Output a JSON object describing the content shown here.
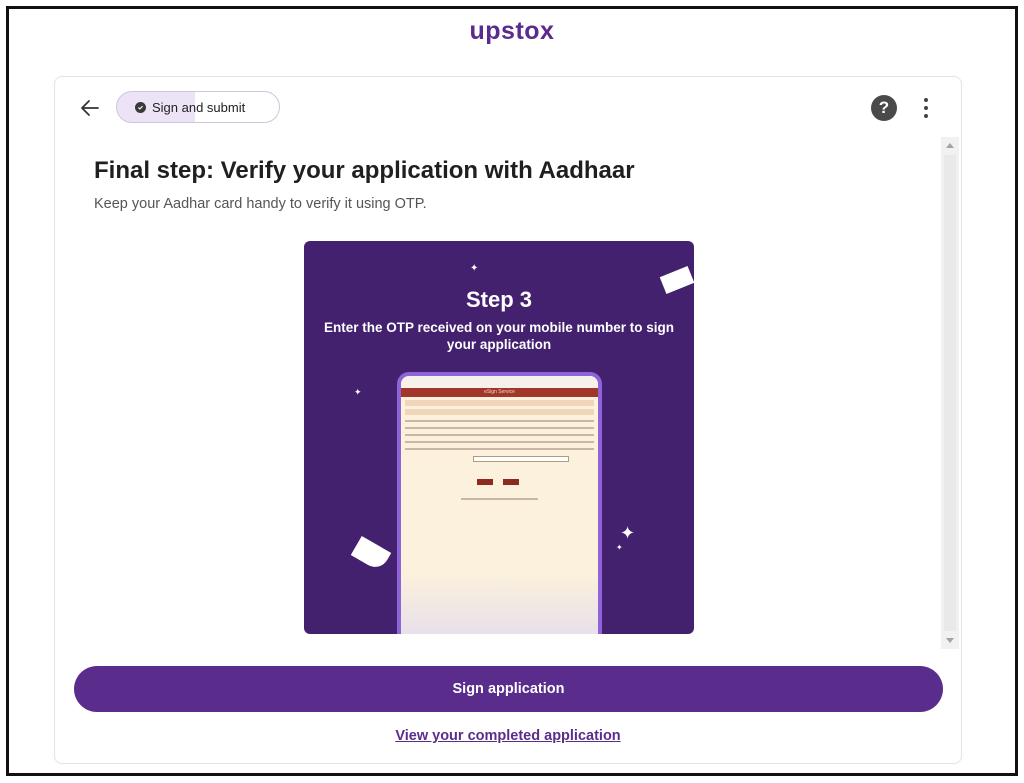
{
  "brand": {
    "logo_text": "upstox",
    "accent_color": "#5a2d8c"
  },
  "header": {
    "back_icon": "arrow-left-icon",
    "chip_label": "Sign and submit",
    "chip_icon": "check-circle-icon",
    "help_icon": "help-circle-icon",
    "help_glyph": "?",
    "menu_icon": "more-vertical-icon"
  },
  "main": {
    "title": "Final step: Verify your application with Aadhaar",
    "subtitle": "Keep your Aadhar card handy to verify it using OTP."
  },
  "promo": {
    "step_title": "Step 3",
    "step_description": "Enter the OTP received on your mobile number to sign your application",
    "background_color": "#43216e",
    "phone_header": "eSign Service"
  },
  "actions": {
    "primary_label": "Sign application",
    "link_label": "View your completed application"
  }
}
